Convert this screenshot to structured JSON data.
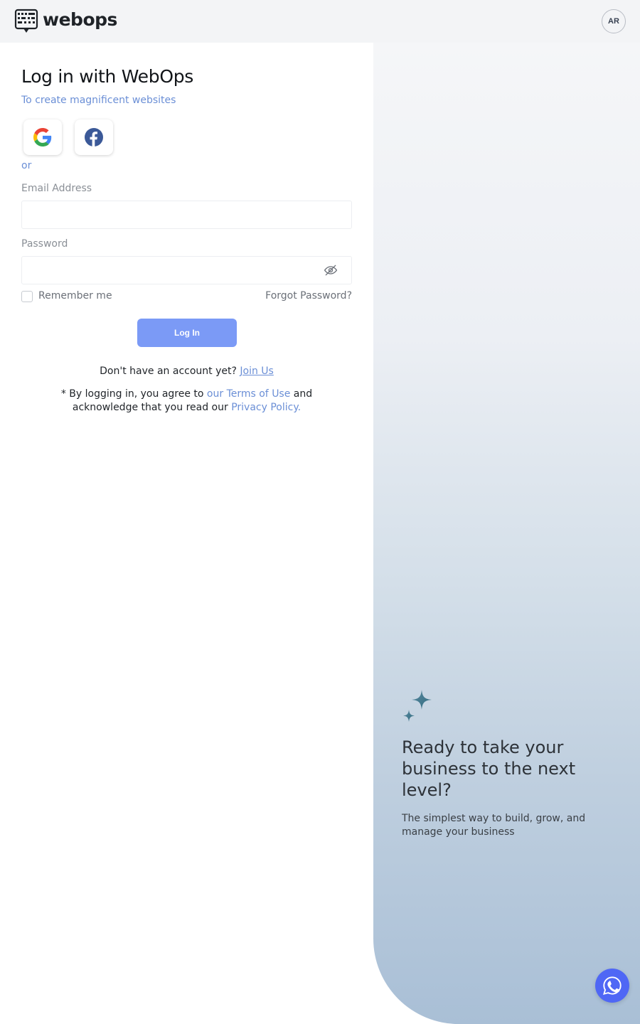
{
  "header": {
    "logo_text": "webops",
    "lang_label": "AR"
  },
  "form": {
    "title": "Log in with WebOps",
    "subtitle": "To create magnificent websites",
    "social": [
      "google-icon",
      "facebook-icon"
    ],
    "or_text": "or",
    "email_label": "Email Address",
    "email_value": "",
    "password_label": "Password",
    "password_value": "",
    "remember_label": "Remember me",
    "forgot_label": "Forgot Password?",
    "login_label": "Log In",
    "signup_prefix": "Don't have an account yet?",
    "signup_link": "Join Us",
    "terms_prefix": "* By logging in, you agree to",
    "terms_link": "our Terms of Use",
    "terms_mid": "and acknowledge that you read our",
    "privacy_link": "Privacy Policy."
  },
  "promo": {
    "title": "Ready to take your business to the next level?",
    "subtitle": "The simplest way to build, grow, and manage your business"
  },
  "colors": {
    "accent": "#6b8fd6",
    "button": "#7b9af6",
    "whatsapp": "#4f67f5"
  }
}
